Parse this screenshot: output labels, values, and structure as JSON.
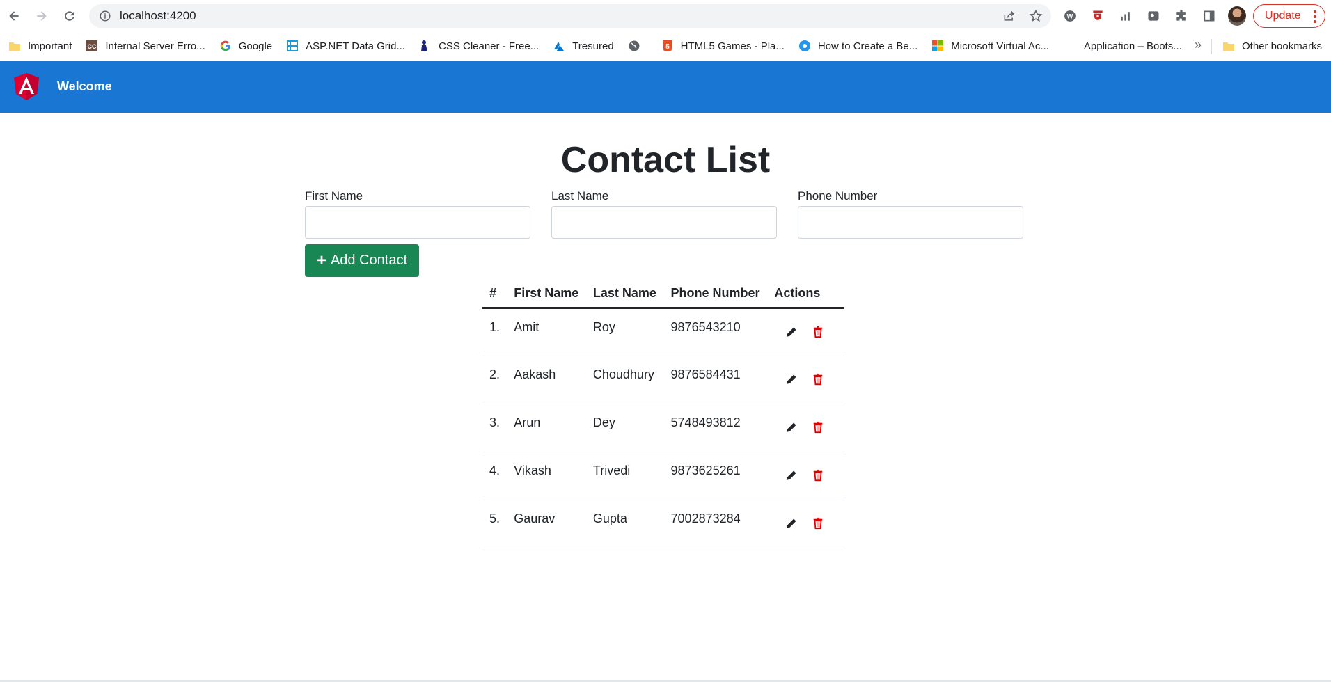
{
  "browser": {
    "url": "localhost:4200",
    "update_label": "Update",
    "bookmarks": [
      {
        "label": "Important",
        "icon": "folder-icon",
        "color": "#f9d56e"
      },
      {
        "label": "Internal Server Erro...",
        "icon": "cc-icon",
        "color": "#6d4c41"
      },
      {
        "label": "Google",
        "icon": "google-icon",
        "color": "#4285f4"
      },
      {
        "label": "ASP.NET Data Grid...",
        "icon": "grid-icon",
        "color": "#1a9be0"
      },
      {
        "label": "CSS Cleaner - Free...",
        "icon": "broom-icon",
        "color": "#1a237e"
      },
      {
        "label": "Tresured",
        "icon": "azure-icon",
        "color": "#0078d4"
      },
      {
        "label": "",
        "icon": "globe-icon",
        "color": "#5f6368"
      },
      {
        "label": "HTML5 Games - Pla...",
        "icon": "html5-icon",
        "color": "#e44d26"
      },
      {
        "label": "How to Create a Be...",
        "icon": "gear-badge-icon",
        "color": "#2196f3"
      },
      {
        "label": "Microsoft Virtual Ac...",
        "icon": "microsoft-icon",
        "color": "#f25022"
      },
      {
        "label": "Application – Boots...",
        "icon": "none",
        "color": "#ffffff"
      }
    ],
    "more_bookmarks": "»",
    "other_bookmarks": "Other bookmarks"
  },
  "app": {
    "nav_title": "Welcome",
    "page_title": "Contact List",
    "form": {
      "first_name_label": "First Name",
      "last_name_label": "Last Name",
      "phone_label": "Phone Number",
      "first_name_value": "",
      "last_name_value": "",
      "phone_value": ""
    },
    "add_button_label": "Add Contact"
  },
  "table": {
    "headers": [
      "#",
      "First Name",
      "Last Name",
      "Phone Number",
      "Actions"
    ],
    "rows": [
      {
        "index": "1.",
        "first": "Amit",
        "last": "Roy",
        "phone": "9876543210"
      },
      {
        "index": "2.",
        "first": "Aakash",
        "last": "Choudhury",
        "phone": "9876584431"
      },
      {
        "index": "3.",
        "first": "Arun",
        "last": "Dey",
        "phone": "5748493812"
      },
      {
        "index": "4.",
        "first": "Vikash",
        "last": "Trivedi",
        "phone": "9873625261"
      },
      {
        "index": "5.",
        "first": "Gaurav",
        "last": "Gupta",
        "phone": "7002873284"
      }
    ]
  },
  "colors": {
    "nav_bg": "#1976d2",
    "add_button": "#198754",
    "delete_icon": "#e00000",
    "edit_icon": "#212529"
  }
}
